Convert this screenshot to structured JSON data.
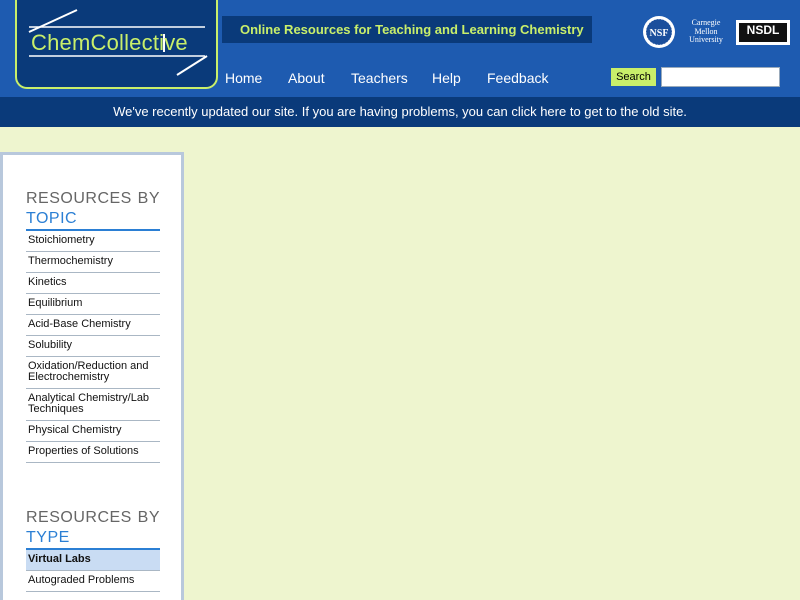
{
  "header": {
    "logo_text": "ChemCollective",
    "tagline": "Online Resources for Teaching and Learning Chemistry",
    "partners": {
      "nsf": "NSF",
      "cmu": [
        "Carnegie",
        "Mellon",
        "University"
      ],
      "nsdl": "NSDL"
    },
    "nav": [
      "Home",
      "About",
      "Teachers",
      "Help",
      "Feedback"
    ],
    "search_label": "Search",
    "search_placeholder": ""
  },
  "notice": "We've recently updated our site. If you are having problems, you can click here to get to the old site.",
  "sidebar": {
    "topic": {
      "title_line1": "RESOURCES BY",
      "title_line2": "TOPIC",
      "items": [
        "Stoichiometry",
        "Thermochemistry",
        "Kinetics",
        "Equilibrium",
        "Acid-Base Chemistry",
        "Solubility",
        "Oxidation/Reduction and Electrochemistry",
        "Analytical Chemistry/Lab Techniques",
        "Physical Chemistry",
        "Properties of Solutions"
      ]
    },
    "type": {
      "title_line1": "RESOURCES BY",
      "title_line2": "TYPE",
      "items": [
        "Virtual Labs",
        "Autograded Problems"
      ],
      "active_index": 0
    }
  },
  "colors": {
    "header_blue": "#1e5bb0",
    "dark_blue": "#0a3a7a",
    "accent_green": "#c9ef6a",
    "page_background": "#eef5cf",
    "link_blue": "#2b7fd4"
  }
}
